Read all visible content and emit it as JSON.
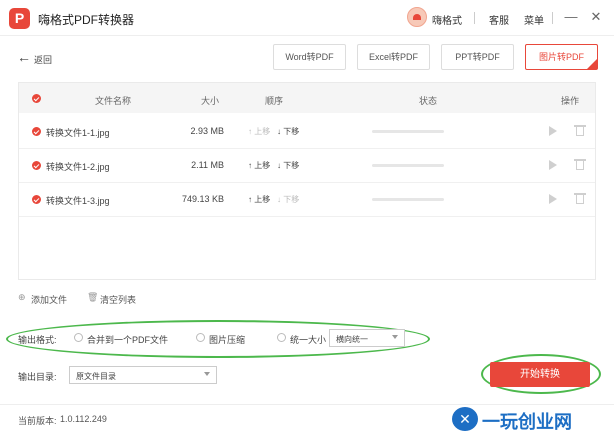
{
  "app": {
    "logo_letter": "P",
    "title": "嗨格式PDF转换器"
  },
  "header": {
    "user_name": "嗨格式",
    "service": "客服",
    "menu": "菜单",
    "minimize": "—",
    "close": "✕"
  },
  "toolbar": {
    "back_label": "返回",
    "formats": [
      "Word转PDF",
      "Excel转PDF",
      "PPT转PDF",
      "图片转PDF"
    ],
    "active_format": "图片转PDF"
  },
  "table": {
    "columns": [
      "文件名称",
      "大小",
      "顺序",
      "状态",
      "操作"
    ],
    "move_up": "上移",
    "move_down": "下移",
    "rows": [
      {
        "name": "转换文件1-1.jpg",
        "size": "2.93 MB",
        "up_enabled": false,
        "down_enabled": true
      },
      {
        "name": "转换文件1-2.jpg",
        "size": "2.11 MB",
        "up_enabled": true,
        "down_enabled": true
      },
      {
        "name": "转换文件1-3.jpg",
        "size": "749.13 KB",
        "up_enabled": true,
        "down_enabled": false
      }
    ]
  },
  "tools": {
    "add_file": "添加文件",
    "clear_list": "清空列表"
  },
  "output": {
    "format_label": "输出格式:",
    "options": [
      "合并到一个PDF文件",
      "图片压缩",
      "统一大小"
    ],
    "unify_select": "横向统一",
    "dir_label": "输出目录:",
    "dir_select": "原文件目录"
  },
  "start_button": "开始转换",
  "footer": {
    "version_label": "当前版本:",
    "version": "1.0.112.249"
  },
  "watermark": {
    "logo": "✕",
    "text": "一玩创业网"
  },
  "colors": {
    "accent": "#e8473a",
    "highlight": "#4cb84c",
    "watermark": "#1d6ec4"
  }
}
